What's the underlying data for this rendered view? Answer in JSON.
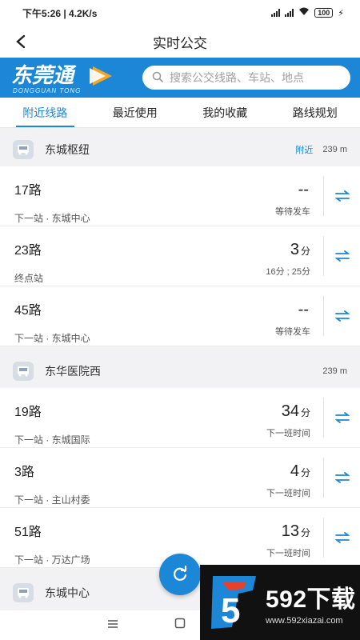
{
  "status_bar": {
    "time_speed": "下午5:26 | 4.2K/s",
    "battery": "100"
  },
  "nav": {
    "title": "实时公交",
    "back_icon": "back-arrow-icon"
  },
  "brand": {
    "logo_text": "东莞通",
    "logo_sub": "DONGGUAN TONG",
    "search_placeholder": "搜索公交线路、车站、地点"
  },
  "tabs": [
    {
      "label": "附近线路",
      "active": true
    },
    {
      "label": "最近使用",
      "active": false
    },
    {
      "label": "我的收藏",
      "active": false
    },
    {
      "label": "路线规划",
      "active": false
    }
  ],
  "stations": [
    {
      "name": "东城枢纽",
      "tag": "附近",
      "distance": "239 m",
      "routes": [
        {
          "line": "17路",
          "next": "下一站 · 东城中心",
          "eta": "--",
          "unit": "",
          "note": "等待发车"
        },
        {
          "line": "23路",
          "next": "终点站",
          "eta": "3",
          "unit": "分",
          "note": "16分 ; 25分"
        },
        {
          "line": "45路",
          "next": "下一站 · 东城中心",
          "eta": "--",
          "unit": "",
          "note": "等待发车"
        }
      ]
    },
    {
      "name": "东华医院西",
      "tag": "",
      "distance": "239 m",
      "routes": [
        {
          "line": "19路",
          "next": "下一站 · 东城国际",
          "eta": "34",
          "unit": "分",
          "note": "下一班时间"
        },
        {
          "line": "3路",
          "next": "下一站 · 主山村委",
          "eta": "4",
          "unit": "分",
          "note": "下一班时间"
        },
        {
          "line": "51路",
          "next": "下一站 · 万达广场",
          "eta": "13",
          "unit": "分",
          "note": "下一班时间"
        }
      ]
    },
    {
      "name": "东城中心",
      "tag": "",
      "distance": "",
      "routes": []
    }
  ],
  "watermark": {
    "big": "592下载",
    "small": "www.592xiazai.com",
    "digit": "5"
  },
  "colors": {
    "accent": "#1b87d6"
  }
}
